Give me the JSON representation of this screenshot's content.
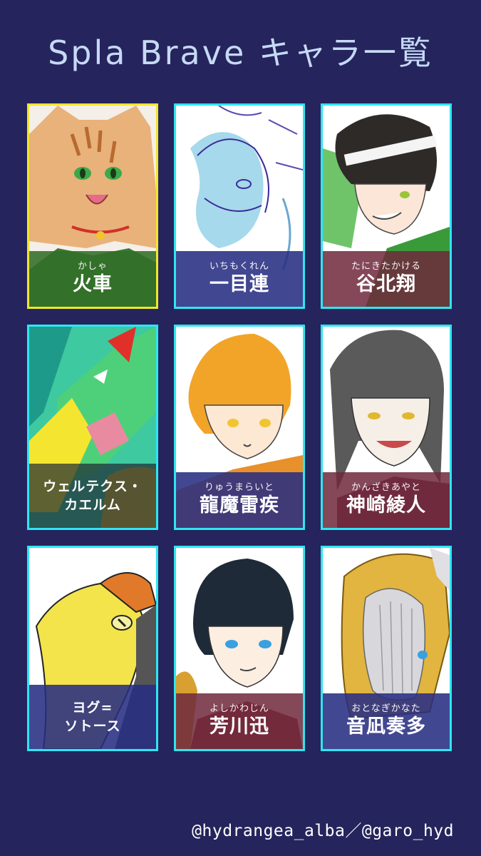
{
  "title": "Spla Brave キャラ一覧",
  "credit": "@hydrangea_alba／@garo_hyd",
  "characters": [
    {
      "ruby": "かしゃ",
      "name": "火車",
      "art": "orange-cat-art"
    },
    {
      "ruby": "いちもくれん",
      "name": "一目連",
      "art": "blue-dragon-sketch-art"
    },
    {
      "ruby": "たにきたかける",
      "name": "谷北翔",
      "art": "boy-headband-art"
    },
    {
      "ruby": "",
      "name_line1": "ウェルテクス・",
      "name_line2": "カエルム",
      "art": "green-dragon-art"
    },
    {
      "ruby": "りゅうまらいと",
      "name": "龍魔雷疾",
      "art": "orange-hair-boy-art"
    },
    {
      "ruby": "かんざきあやと",
      "name": "神崎綾人",
      "art": "grey-hair-man-art"
    },
    {
      "ruby": "",
      "name_line1": "ヨグ=",
      "name_line2": "ソトース",
      "art": "yellow-serpent-art"
    },
    {
      "ruby": "よしかわじん",
      "name": "芳川迅",
      "art": "dark-hair-boy-art"
    },
    {
      "ruby": "おとなぎかなた",
      "name": "音凪奏多",
      "art": "gold-fish-creature-art"
    }
  ]
}
